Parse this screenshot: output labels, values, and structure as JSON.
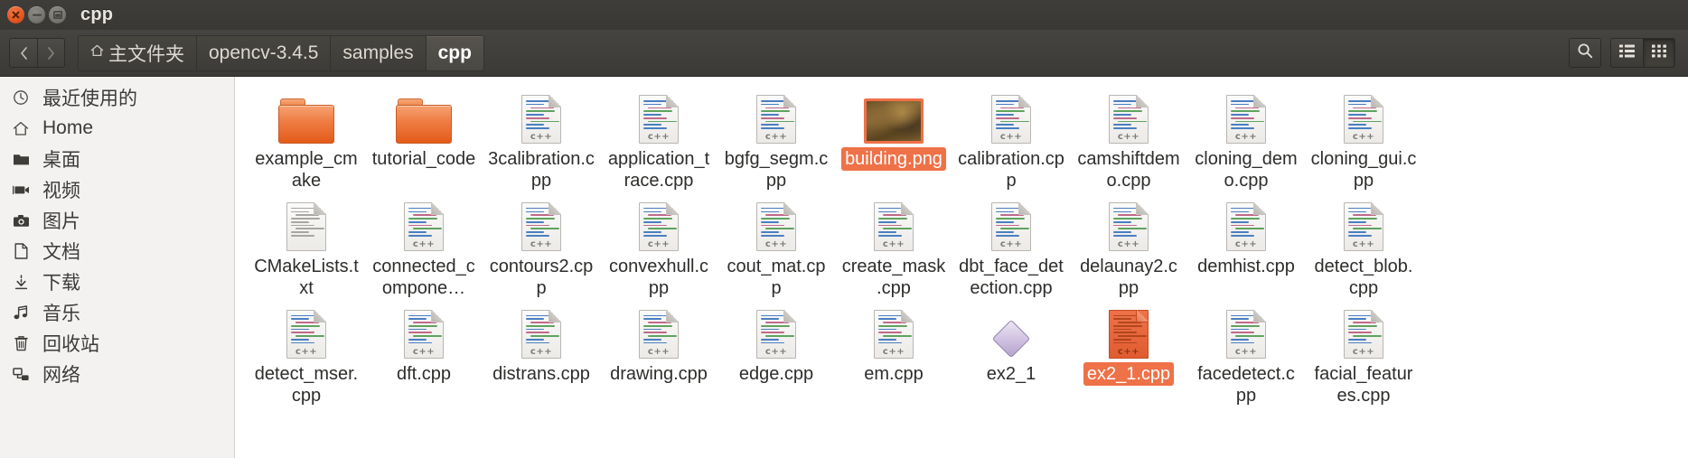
{
  "window": {
    "title": "cpp",
    "buttons": {
      "close": "close-button",
      "minimize": "minimize-button",
      "maximize": "maximize-button"
    }
  },
  "toolbar": {
    "back_label": "‹",
    "forward_label": "›",
    "breadcrumbs": [
      {
        "label": "主文件夹",
        "home": true,
        "active": false
      },
      {
        "label": "opencv-3.4.5",
        "home": false,
        "active": false
      },
      {
        "label": "samples",
        "home": false,
        "active": false
      },
      {
        "label": "cpp",
        "home": false,
        "active": true
      }
    ],
    "search_label": "search-icon",
    "list_view_label": "list-view-icon",
    "grid_view_label": "grid-view-icon"
  },
  "sidebar": {
    "items": [
      {
        "label": "最近使用的",
        "icon": "clock-icon"
      },
      {
        "label": "Home",
        "icon": "home-icon"
      },
      {
        "label": "桌面",
        "icon": "folder-icon"
      },
      {
        "label": "视频",
        "icon": "video-icon"
      },
      {
        "label": "图片",
        "icon": "camera-icon"
      },
      {
        "label": "文档",
        "icon": "document-icon"
      },
      {
        "label": "下载",
        "icon": "download-icon"
      },
      {
        "label": "音乐",
        "icon": "music-icon"
      },
      {
        "label": "回收站",
        "icon": "trash-icon"
      },
      {
        "label": "网络",
        "icon": "network-icon"
      }
    ]
  },
  "files": {
    "items": [
      {
        "name": "example_cmake",
        "type": "folder",
        "selected": false
      },
      {
        "name": "tutorial_code",
        "type": "folder",
        "selected": false
      },
      {
        "name": "3calibration.cpp",
        "type": "cpp",
        "selected": false
      },
      {
        "name": "application_trace.cpp",
        "type": "cpp",
        "selected": false
      },
      {
        "name": "bgfg_segm.cpp",
        "type": "cpp",
        "selected": false
      },
      {
        "name": "building.png",
        "type": "image",
        "selected": true
      },
      {
        "name": "calibration.cpp",
        "type": "cpp",
        "selected": false
      },
      {
        "name": "camshiftdemo.cpp",
        "type": "cpp",
        "selected": false
      },
      {
        "name": "cloning_demo.cpp",
        "type": "cpp",
        "selected": false
      },
      {
        "name": "cloning_gui.cpp",
        "type": "cpp",
        "selected": false
      },
      {
        "name": "CMakeLists.txt",
        "type": "text",
        "selected": false
      },
      {
        "name": "connected_compone…",
        "type": "cpp",
        "selected": false
      },
      {
        "name": "contours2.cpp",
        "type": "cpp",
        "selected": false
      },
      {
        "name": "convexhull.cpp",
        "type": "cpp",
        "selected": false
      },
      {
        "name": "cout_mat.cpp",
        "type": "cpp",
        "selected": false
      },
      {
        "name": "create_mask.cpp",
        "type": "cpp",
        "selected": false
      },
      {
        "name": "dbt_face_detection.cpp",
        "type": "cpp",
        "selected": false
      },
      {
        "name": "delaunay2.cpp",
        "type": "cpp",
        "selected": false
      },
      {
        "name": "demhist.cpp",
        "type": "cpp",
        "selected": false
      },
      {
        "name": "detect_blob.cpp",
        "type": "cpp",
        "selected": false
      },
      {
        "name": "detect_mser.cpp",
        "type": "cpp",
        "selected": false
      },
      {
        "name": "dft.cpp",
        "type": "cpp",
        "selected": false
      },
      {
        "name": "distrans.cpp",
        "type": "cpp",
        "selected": false
      },
      {
        "name": "drawing.cpp",
        "type": "cpp",
        "selected": false
      },
      {
        "name": "edge.cpp",
        "type": "cpp",
        "selected": false
      },
      {
        "name": "em.cpp",
        "type": "cpp",
        "selected": false
      },
      {
        "name": "ex2_1",
        "type": "executable",
        "selected": false
      },
      {
        "name": "ex2_1.cpp",
        "type": "cpp",
        "selected": true
      },
      {
        "name": "facedetect.cpp",
        "type": "cpp",
        "selected": false
      },
      {
        "name": "facial_features.cpp",
        "type": "cpp",
        "selected": false
      }
    ]
  },
  "colors": {
    "selection": "#ef7148",
    "folder": "#ef7d44",
    "titlebar": "#3f3d3a",
    "sidebar_bg": "#f4f2f0"
  }
}
